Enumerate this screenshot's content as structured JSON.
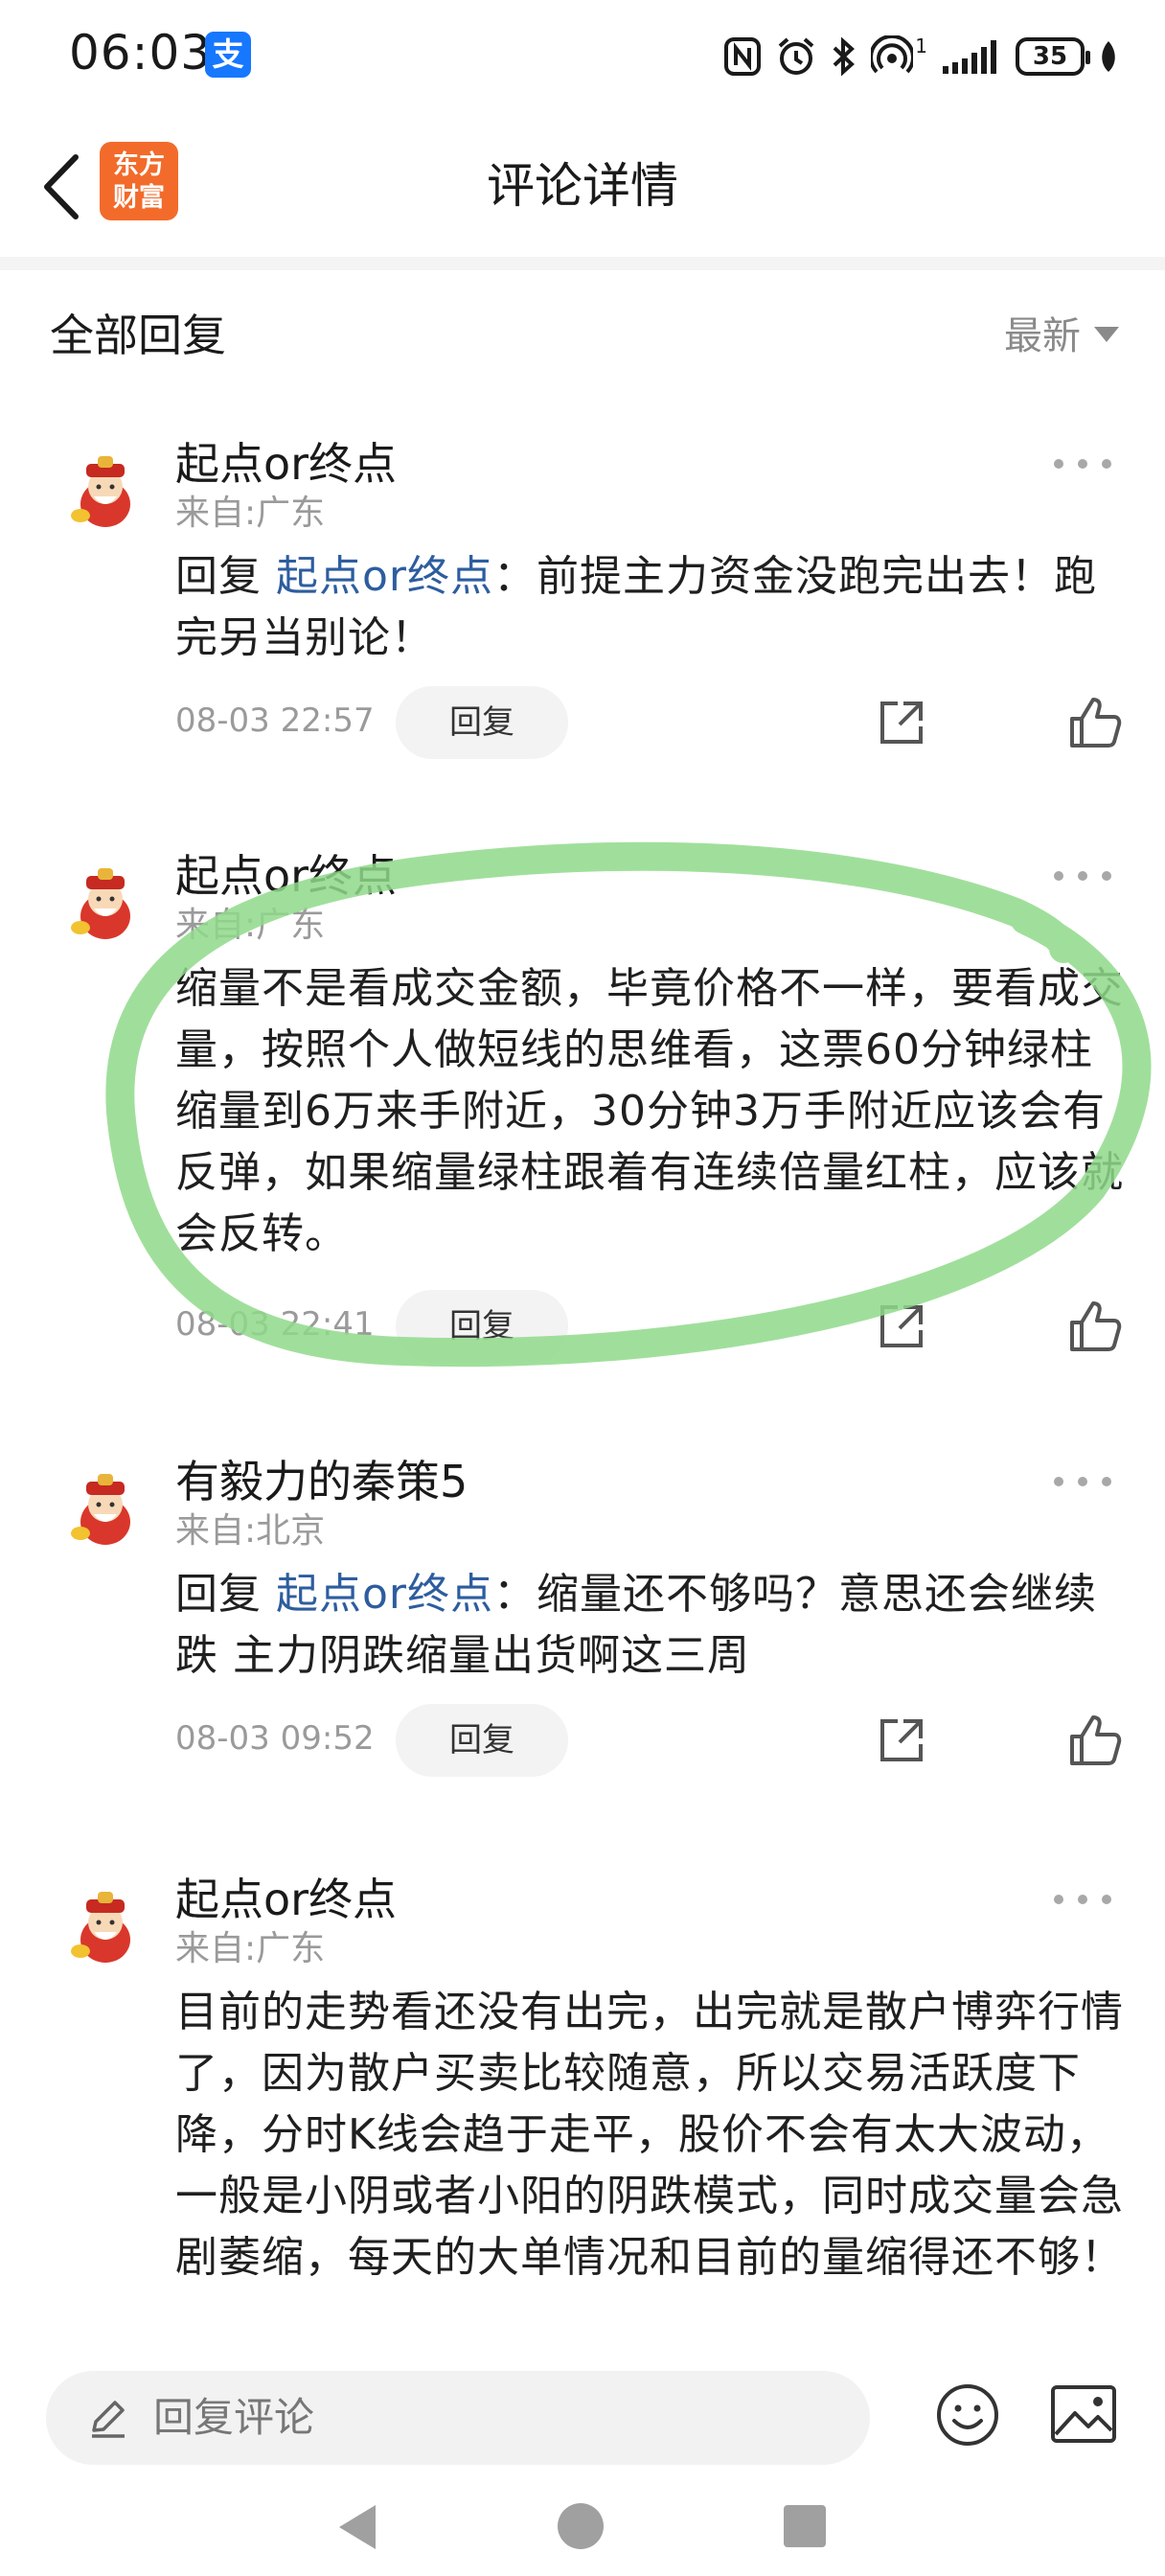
{
  "status_bar": {
    "time": "06:03",
    "alipay_glyph": "支",
    "signal_superscript": "1",
    "battery": "35"
  },
  "header": {
    "title": "评论详情",
    "app_logo_line1": "东方",
    "app_logo_line2": "财富"
  },
  "sort": {
    "section_title": "全部回复",
    "sort_label": "最新"
  },
  "comments": [
    {
      "username": "起点or终点",
      "location": "来自:广东",
      "reply_prefix": " 回复 ",
      "mention": "起点or终点",
      "text": "：前提主力资金没跑完出去！跑完另当别论！",
      "timestamp": "08-03 22:57",
      "reply_label": "回复"
    },
    {
      "username": "起点or终点",
      "location": "来自:广东",
      "text": "缩量不是看成交金额，毕竟价格不一样，要看成交量，按照个人做短线的思维看，这票60分钟绿柱缩量到6万来手附近，30分钟3万手附近应该会有反弹，如果缩量绿柱跟着有连续倍量红柱，应该就会反转。",
      "timestamp": "08-03 22:41",
      "reply_label": "回复"
    },
    {
      "username": "有毅力的秦策5",
      "location": "来自:北京",
      "reply_prefix": " 回复 ",
      "mention": "起点or终点",
      "text": "：缩量还不够吗？意思还会继续跌 主力阴跌缩量出货啊这三周",
      "timestamp": "08-03 09:52",
      "reply_label": "回复"
    },
    {
      "username": "起点or终点",
      "location": "来自:广东",
      "text": "目前的走势看还没有出完，出完就是散户博弈行情了，因为散户买卖比较随意，所以交易活跃度下降，分时K线会趋于走平，股价不会有太大波动，一般是小阴或者小阳的阴跌模式，同时成交量会急剧萎缩，每天的大单情况和目前的量缩得还不够！"
    }
  ],
  "bottom_bar": {
    "input_placeholder": "回复评论"
  },
  "icons": {
    "back": "chevron-left-icon",
    "more": "more-dots-icon",
    "share": "share-icon",
    "like": "thumbs-up-icon",
    "edit": "pencil-icon",
    "emoji": "emoji-icon",
    "image": "image-icon"
  },
  "colors": {
    "mention": "#2d5d9f",
    "highlight": "#8fd98a",
    "app_brand": "#f26b2b",
    "alipay": "#1677ff"
  }
}
